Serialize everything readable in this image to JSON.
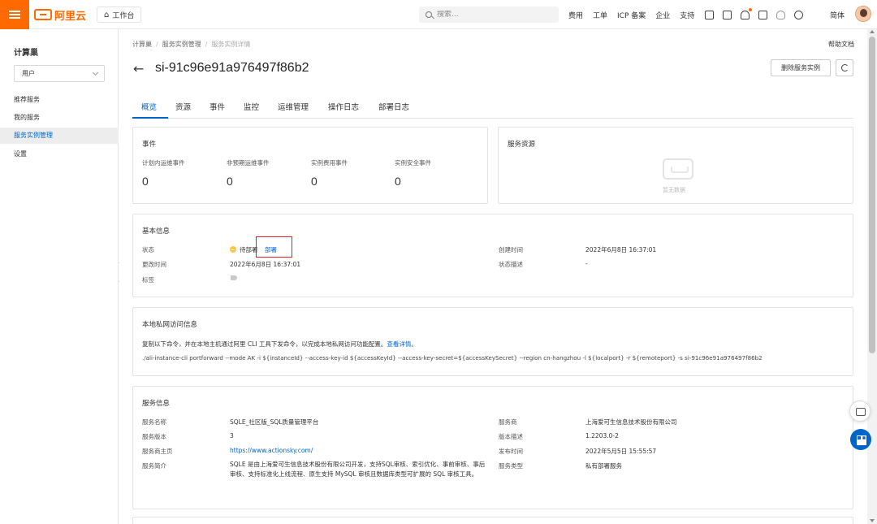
{
  "topbar": {
    "logo_text": "阿里云",
    "workbench_label": "工作台",
    "search_placeholder": "搜索...",
    "nav": [
      "费用",
      "工单",
      "ICP 备案",
      "企业",
      "支持"
    ],
    "lang": "简体",
    "icons": [
      "cloud-shell-icon",
      "terminal-icon",
      "bell-icon",
      "cart-icon",
      "bulb-icon",
      "help-icon"
    ]
  },
  "sidebar": {
    "title": "计算巢",
    "select_value": "用户",
    "items": [
      {
        "label": "推荐服务"
      },
      {
        "label": "我的服务"
      },
      {
        "label": "服务实例管理",
        "active": true
      },
      {
        "label": "设置"
      }
    ]
  },
  "breadcrumb": [
    "计算巢",
    "服务实例管理",
    "服务实例详情"
  ],
  "help_doc": "帮助文档",
  "instance": {
    "id": "si-91c96e91a976497f86b2",
    "delete_label": "删除服务实例"
  },
  "tabs": [
    "概览",
    "资源",
    "事件",
    "监控",
    "运维管理",
    "操作日志",
    "部署日志"
  ],
  "events": {
    "title": "事件",
    "items": [
      {
        "label": "计划内运维事件",
        "value": "0"
      },
      {
        "label": "非预期运维事件",
        "value": "0"
      },
      {
        "label": "实例费用事件",
        "value": "0"
      },
      {
        "label": "实例安全事件",
        "value": "0"
      }
    ]
  },
  "resources": {
    "title": "服务资源",
    "empty_text": "暂无数据"
  },
  "basic": {
    "title": "基本信息",
    "status_label": "状态",
    "status_value": "待部署",
    "status_action": "部署",
    "updated_label": "更改时间",
    "updated_value": "2022年6月8日 16:37:01",
    "tags_label": "标签",
    "created_label": "创建时间",
    "created_value": "2022年6月8日 16:37:01",
    "status_desc_label": "状态描述",
    "status_desc_value": "-"
  },
  "private_access": {
    "title": "本地私网访问信息",
    "instruction": "复制以下命令，并在本地主机通过阿里 CLI 工具下发命令，以完成本地私网访问功能配置。",
    "detail_link": "查看详情。",
    "command": "./ali-instance-cli portforward --mode AK -i ${instanceId} --access-key-id ${accessKeyId} --access-key-secret=${accessKeySecret} --region cn-hangzhou -l ${localport} -r ${remoteport} -s si-91c96e91a976497f86b2"
  },
  "service": {
    "title": "服务信息",
    "name_label": "服务名称",
    "name_value": "SQLE_社区版_SQL质量管理平台",
    "version_label": "服务版本",
    "version_value": "3",
    "homepage_label": "服务商主页",
    "homepage_value": "https://www.actionsky.com/",
    "intro_label": "服务简介",
    "intro_value": "SQLE 是由上海爱可生信息技术股份有限公司开发，支持SQL审核、索引优化、事前审核、事后审核、支持标准化上线流程、原生支持 MySQL 审核且数据库类型可扩展的 SQL 审核工具。",
    "provider_label": "服务商",
    "provider_value": "上海爱可生信息技术股份有限公司",
    "version_desc_label": "版本描述",
    "version_desc_value": "1.2203.0-2",
    "release_label": "发布时间",
    "release_value": "2022年5月5日 15:55:57",
    "type_label": "服务类型",
    "type_value": "私有部署服务"
  },
  "colors": {
    "brand": "#ff6a00",
    "accent": "#0064c8",
    "highlight": "#e12020",
    "status_pending": "#ffc440"
  }
}
